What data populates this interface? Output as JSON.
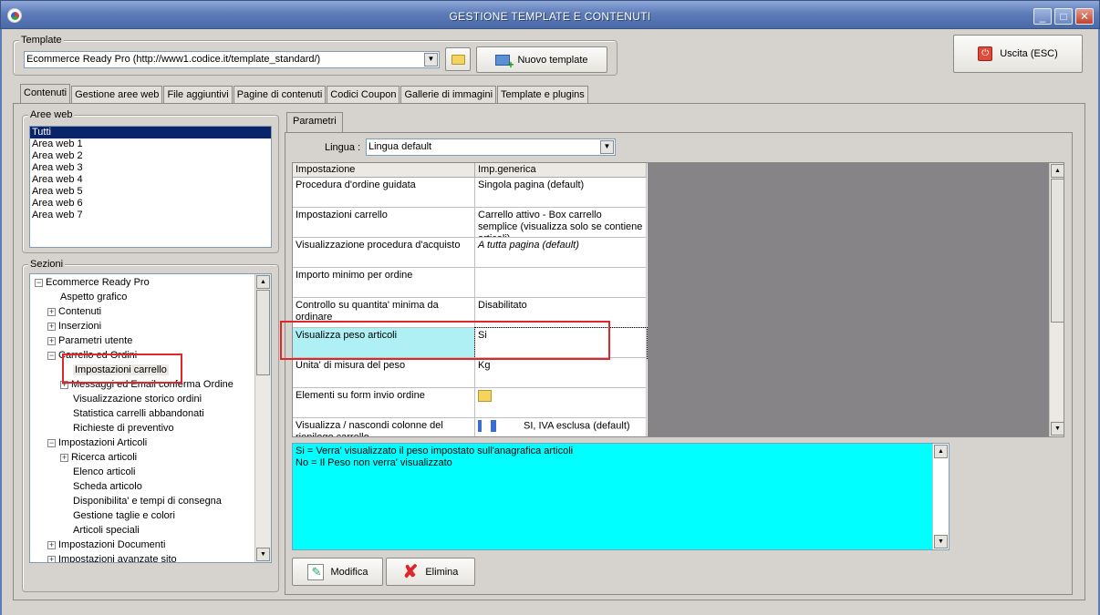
{
  "window": {
    "title": "GESTIONE TEMPLATE E CONTENUTI",
    "minimize": "_",
    "maximize": "□",
    "close": "✕"
  },
  "template": {
    "group_label": "Template",
    "value": "Ecommerce Ready Pro (http://www1.codice.it/template_standard/)",
    "new_button": "Nuovo template"
  },
  "exit_button": "Uscita (ESC)",
  "tabs": [
    "Contenuti",
    "Gestione aree web",
    "File aggiuntivi",
    "Pagine di contenuti",
    "Codici Coupon",
    "Gallerie di immagini",
    "Template e plugins"
  ],
  "aree_web": {
    "label": "Aree web",
    "items": [
      "Tutti",
      "Area web 1",
      "Area web 2",
      "Area web 3",
      "Area web 4",
      "Area web 5",
      "Area web 6",
      "Area web 7"
    ]
  },
  "sezioni": {
    "label": "Sezioni",
    "nodes": [
      {
        "text": "Ecommerce Ready Pro",
        "exp": "−",
        "lvl": 0
      },
      {
        "text": "Aspetto grafico",
        "exp": "",
        "lvl": 1
      },
      {
        "text": "Contenuti",
        "exp": "+",
        "lvl": 1
      },
      {
        "text": "Inserzioni",
        "exp": "+",
        "lvl": 1
      },
      {
        "text": "Parametri utente",
        "exp": "+",
        "lvl": 1
      },
      {
        "text": "Carrello ed Ordini",
        "exp": "−",
        "lvl": 1
      },
      {
        "text": "Impostazioni carrello",
        "exp": "",
        "lvl": 2
      },
      {
        "text": "Messaggi ed Email conferma Ordine",
        "exp": "+",
        "lvl": 2
      },
      {
        "text": "Visualizzazione storico ordini",
        "exp": "",
        "lvl": 2
      },
      {
        "text": "Statistica carrelli abbandonati",
        "exp": "",
        "lvl": 2
      },
      {
        "text": "Richieste di preventivo",
        "exp": "",
        "lvl": 2
      },
      {
        "text": "Impostazioni Articoli",
        "exp": "−",
        "lvl": 1
      },
      {
        "text": "Ricerca articoli",
        "exp": "+",
        "lvl": 2
      },
      {
        "text": "Elenco articoli",
        "exp": "",
        "lvl": 2
      },
      {
        "text": "Scheda articolo",
        "exp": "",
        "lvl": 2
      },
      {
        "text": "Disponibilita' e tempi di consegna",
        "exp": "",
        "lvl": 2
      },
      {
        "text": "Gestione taglie e colori",
        "exp": "",
        "lvl": 2
      },
      {
        "text": "Articoli speciali",
        "exp": "",
        "lvl": 2
      },
      {
        "text": "Impostazioni Documenti",
        "exp": "+",
        "lvl": 1
      },
      {
        "text": "Impostazioni avanzate sito",
        "exp": "+",
        "lvl": 1
      }
    ]
  },
  "parametri": {
    "tab": "Parametri",
    "lingua_label": "Lingua :",
    "lingua_value": "Lingua default",
    "headers": [
      "Impostazione",
      "Imp.generica"
    ],
    "rows": [
      [
        "Procedura d'ordine guidata",
        "Singola pagina (default)"
      ],
      [
        "Impostazioni carrello",
        "Carrello attivo - Box carrello semplice (visualizza solo se contiene articoli)"
      ],
      [
        "Visualizzazione procedura d'acquisto",
        "A tutta pagina (default)"
      ],
      [
        "Importo minimo per ordine",
        ""
      ],
      [
        "Controllo su quantita' minima da ordinare",
        "Disabilitato"
      ],
      [
        "Visualizza peso articoli",
        "Si"
      ],
      [
        "Unita' di misura del peso",
        "Kg"
      ],
      [
        "Elementi su form invio ordine",
        ""
      ],
      [
        "Visualizza / nascondi colonne del riepilogo carrello",
        "SI, IVA esclusa (default)"
      ]
    ],
    "info_lines": [
      "Si = Verra' visualizzato il peso impostato sull'anagrafica articoli",
      "No = Il Peso non verra' visualizzato"
    ]
  },
  "actions": {
    "modifica": "Modifica",
    "elimina": "Elimina"
  }
}
